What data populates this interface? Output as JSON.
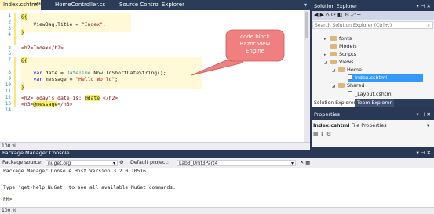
{
  "editor_tabs": [
    {
      "label": "Index.cshtml*",
      "active": true
    },
    {
      "label": "HomeController.cs",
      "active": false
    },
    {
      "label": "Source Control Explorer",
      "active": false
    }
  ],
  "tab_close_glyph": "✕",
  "editor": {
    "line_numbers": [
      "1",
      "2",
      "3",
      "4",
      "5",
      "6",
      "7",
      "8",
      "9",
      "10",
      "11",
      "12",
      "13",
      "14"
    ],
    "code": {
      "l1_at": "@{",
      "l2_indent": "    ",
      "l2_a": "ViewBag.Title = ",
      "l2_str": "\"Index\"",
      "l2_end": ";",
      "l3": "}",
      "l5": "<h2>Index</h2>",
      "l7_at": "@{",
      "l8_var": "var",
      "l8_a": " date = ",
      "l8_type": "DateTime",
      "l8_b": ".Now.ToShortDateString();",
      "l9_var": "var",
      "l9_a": " message = ",
      "l9_str": "\"Hello World\"",
      "l9_end": ";",
      "l10": "}",
      "l12_a": "<h2>Today's date is: ",
      "l12_at": "@date",
      "l12_b": " </h2>",
      "l13_a": "<h3>",
      "l13_at": "@message",
      "l13_b": "</h3>"
    },
    "zoom": "100 %"
  },
  "callout": {
    "line1": "code block",
    "line2": "Razor View",
    "line3": "Engine"
  },
  "solution_explorer": {
    "title": "Solution Explorer",
    "search_placeholder": "Search Solution Explorer (Ctrl+;)",
    "items": [
      {
        "label": "fonts",
        "type": "folder"
      },
      {
        "label": "Models",
        "type": "folder"
      },
      {
        "label": "Scripts",
        "type": "folder"
      },
      {
        "label": "Views",
        "type": "folder"
      },
      {
        "label": "Home",
        "type": "folder"
      },
      {
        "label": "Index.cshtml",
        "type": "file"
      },
      {
        "label": "Shared",
        "type": "folder"
      },
      {
        "label": "_Layout.cshtml",
        "type": "file"
      }
    ],
    "tabs": [
      "Solution Explorer",
      "Team Explorer"
    ]
  },
  "properties": {
    "title": "Properties",
    "object_name": "Index.cshtml",
    "object_type": "File Properties"
  },
  "package_manager": {
    "title": "Package Manager Console",
    "source_label": "Package source:",
    "source_value": "nuget.org",
    "project_label": "Default project:",
    "project_value": "Lab3_Unit3Part4",
    "line1": "Package Manager Console Host Version 3.2.0.10516",
    "line2": "Type 'get-help NuGet' to see all available NuGet commands.",
    "prompt": "PM>",
    "zoom": "100 %"
  },
  "colors": {
    "chrome": "#293955",
    "selection": "#3399ff",
    "callout_fill": "#f07f7f",
    "keyword": "#0000ff",
    "string": "#a31515",
    "type": "#2b91af",
    "razor_bg": "#fdf35e"
  }
}
